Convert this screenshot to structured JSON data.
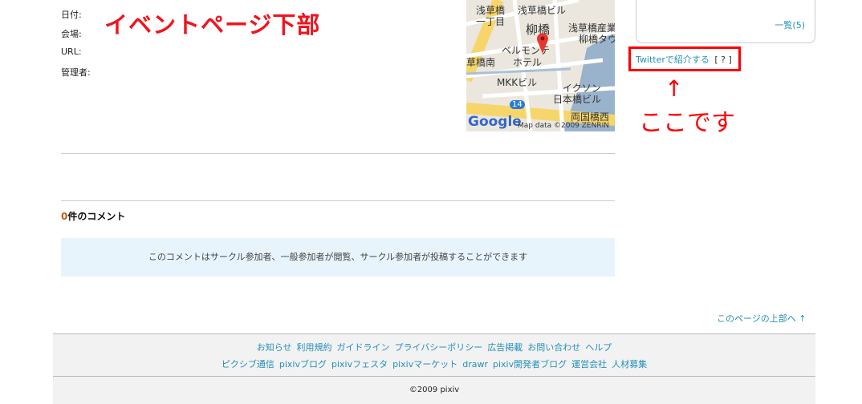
{
  "event_info": {
    "labels": [
      "日付:",
      "会場:",
      "URL:",
      "管理者:"
    ]
  },
  "annotations": {
    "title": "イベントページ下部",
    "arrow": "↑",
    "here": "ここです"
  },
  "map": {
    "labels": [
      "浅草橋",
      "一丁目",
      "浅草橋ビル",
      "柳橋",
      "浅草橋産業",
      "柳橋タウ",
      "ベルモンテ",
      "ホテル",
      "草橋南",
      "MKKビル",
      "イクソン",
      "日本橋ビル",
      "両国橋西"
    ],
    "route": "14",
    "logo": "Google",
    "credit": "Map data ©2009 ZENRIN"
  },
  "comments": {
    "count": "0",
    "count_suffix": "件のコメント",
    "notice": "このコメントはサークル参加者、一般参加者が閲覧、サークル参加者が投稿することができます"
  },
  "sidebar": {
    "list_link": "一覧(5)",
    "twitter_link": "Twitterで紹介する",
    "help": "[ ? ]"
  },
  "to_top": "このページの上部へ ↑",
  "footer": {
    "row1": [
      "お知らせ",
      "利用規約",
      "ガイドライン",
      "プライバシーポリシー",
      "広告掲載",
      "お問い合わせ",
      "ヘルプ"
    ],
    "row2": [
      "ピクシブ通信",
      "pixivブログ",
      "pixivフェスタ",
      "pixivマーケット",
      "drawr",
      "pixiv開発者ブログ",
      "運営会社",
      "人材募集"
    ],
    "copyright": "©2009 pixiv"
  },
  "colors": {
    "accent": "#258fb8",
    "annotation": "#f0141e"
  }
}
